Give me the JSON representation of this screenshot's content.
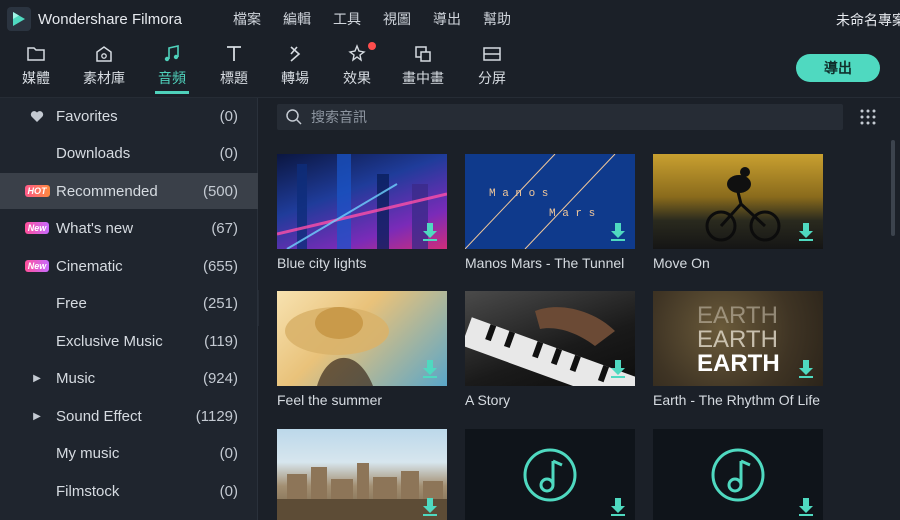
{
  "app": {
    "title": "Wondershare Filmora",
    "project_name": "未命名專案",
    "menu": [
      "檔案",
      "編輯",
      "工具",
      "視圖",
      "導出",
      "幫助"
    ]
  },
  "toolbar": {
    "tools": [
      {
        "label": "媒體",
        "icon": "folder-icon"
      },
      {
        "label": "素材庫",
        "icon": "library-icon"
      },
      {
        "label": "音頻",
        "icon": "music-note-icon",
        "active": true
      },
      {
        "label": "標題",
        "icon": "title-text-icon"
      },
      {
        "label": "轉場",
        "icon": "transition-icon"
      },
      {
        "label": "效果",
        "icon": "effects-icon"
      },
      {
        "label": "畫中畫",
        "icon": "pip-icon"
      },
      {
        "label": "分屏",
        "icon": "split-screen-icon"
      }
    ],
    "export_label": "導出"
  },
  "sidebar": {
    "items": [
      {
        "label": "Favorites",
        "count": "(0)",
        "icon": "heart-icon"
      },
      {
        "label": "Downloads",
        "count": "(0)"
      },
      {
        "label": "Recommended",
        "count": "(500)",
        "tag": "HOT",
        "active": true
      },
      {
        "label": "What's new",
        "count": "(67)",
        "tag": "New"
      },
      {
        "label": "Cinematic",
        "count": "(655)",
        "tag": "New"
      },
      {
        "label": "Free",
        "count": "(251)"
      },
      {
        "label": "Exclusive Music",
        "count": "(119)"
      },
      {
        "label": "Music",
        "count": "(924)",
        "expandable": true
      },
      {
        "label": "Sound Effect",
        "count": "(1129)",
        "expandable": true
      },
      {
        "label": "My music",
        "count": "(0)"
      },
      {
        "label": "Filmstock",
        "count": "(0)"
      }
    ]
  },
  "search": {
    "placeholder": "搜索音訊"
  },
  "tracks": [
    {
      "title": "Blue city lights"
    },
    {
      "title": "Manos Mars - The Tunnel"
    },
    {
      "title": "Move On"
    },
    {
      "title": "Feel the summer"
    },
    {
      "title": "A Story"
    },
    {
      "title": "Earth - The Rhythm Of Life"
    },
    {
      "title": ""
    },
    {
      "title": ""
    },
    {
      "title": ""
    }
  ],
  "thumb_text": {
    "manos": [
      "M a n o s",
      "M a r s"
    ],
    "earth": [
      "EARTH",
      "EARTH",
      "EARTH"
    ]
  },
  "colors": {
    "accent": "#4fd9c0",
    "background": "#1b2028",
    "sidebar": "#1f252e",
    "active_row": "#3a4049"
  }
}
